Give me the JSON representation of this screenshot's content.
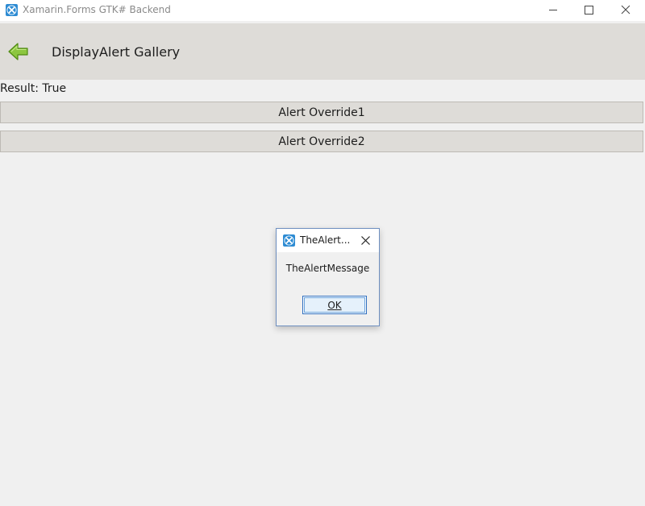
{
  "window": {
    "title": "Xamarin.Forms GTK# Backend",
    "icon": "xamarin-icon",
    "controls": [
      "minimize-icon",
      "maximize-icon",
      "close-icon"
    ]
  },
  "navbar": {
    "back_icon": "back-arrow-icon",
    "title": "DisplayAlert Gallery"
  },
  "content": {
    "result_label": "Result: True",
    "buttons": [
      "Alert Override1",
      "Alert Override2"
    ]
  },
  "dialog": {
    "title": "TheAlert...",
    "message": "TheAlertMessage",
    "ok_label": "OK"
  },
  "colors": {
    "window_bg": "#f0f0f0",
    "navbar_bg": "#dedcd8",
    "button_bg": "#dedcd8",
    "back_arrow": "#76b82a",
    "dialog_border": "#6e8fc0",
    "accent": "#2d8bd3"
  }
}
